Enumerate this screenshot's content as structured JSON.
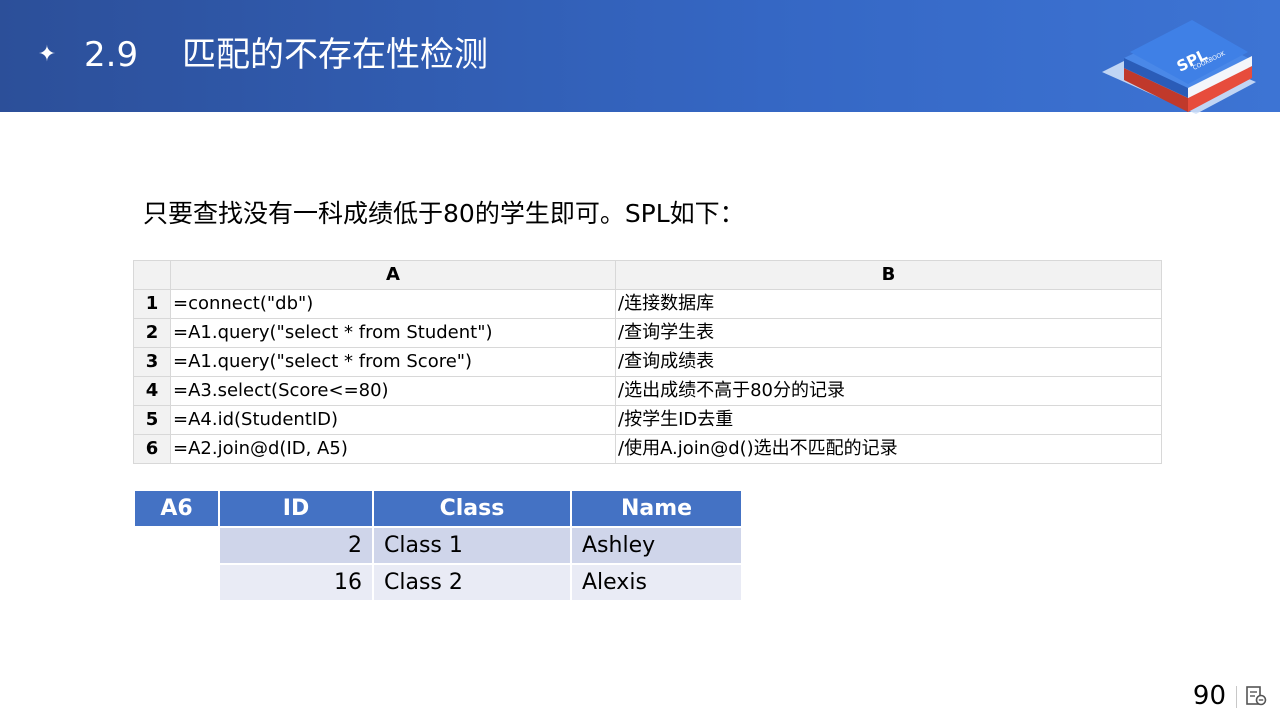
{
  "header": {
    "section_number": "2.9",
    "title": "匹配的不存在性检测",
    "logo_text_main": "SPL",
    "logo_text_sub": "COOKBOOK"
  },
  "intro_text": "只要查找没有一科成绩低于80的学生即可。SPL如下：",
  "code_grid": {
    "columns": [
      "A",
      "B"
    ],
    "rows": [
      {
        "num": "1",
        "a": "=connect(\"db\")",
        "b": "/连接数据库"
      },
      {
        "num": "2",
        "a": "=A1.query(\"select * from Student\")",
        "b": "/查询学生表"
      },
      {
        "num": "3",
        "a": "=A1.query(\"select * from Score\")",
        "b": "/查询成绩表"
      },
      {
        "num": "4",
        "a": "=A3.select(Score<=80)",
        "b": "/选出成绩不高于80分的记录"
      },
      {
        "num": "5",
        "a": "=A4.id(StudentID)",
        "b": "/按学生ID去重"
      },
      {
        "num": "6",
        "a": "=A2.join@d(ID, A5)",
        "b": "/使用A.join@d()选出不匹配的记录"
      }
    ]
  },
  "result_table": {
    "label": "A6",
    "headers": [
      "ID",
      "Class",
      "Name"
    ],
    "rows": [
      {
        "id": "2",
        "class": "Class 1",
        "name": "Ashley"
      },
      {
        "id": "16",
        "class": "Class 2",
        "name": "Alexis"
      }
    ]
  },
  "footer": {
    "page_number": "90"
  },
  "colors": {
    "header_start": "#2c4f99",
    "header_end": "#3d74d4",
    "table_header": "#4472c4",
    "row_dark": "#cfd5ea",
    "row_light": "#e9ebf5"
  },
  "icons": [
    "sparkle-icon",
    "book-stack-logo-icon",
    "notes-icon"
  ]
}
